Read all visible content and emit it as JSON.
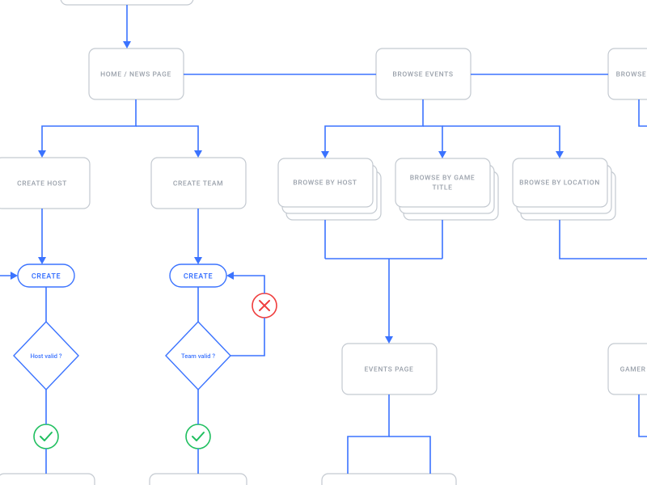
{
  "nodes": {
    "home": {
      "label": "HOME / NEWS PAGE"
    },
    "browseEvents": {
      "label": "BROWSE EVENTS"
    },
    "browseG": {
      "label": "BROWSE G"
    },
    "createHost": {
      "label": "CREATE HOST"
    },
    "createTeam": {
      "label": "CREATE TEAM"
    },
    "byHost": {
      "label": "BROWSE BY HOST"
    },
    "byGameTitle": {
      "label": "BROWSE BY GAME TITLE"
    },
    "byLocation": {
      "label": "BROWSE BY LOCATION"
    },
    "eventsPage": {
      "label": "EVENTS PAGE"
    },
    "gamerP": {
      "label": "GAMER P"
    }
  },
  "pills": {
    "create1": {
      "label": "CREATE"
    },
    "create2": {
      "label": "CREATE"
    }
  },
  "decisions": {
    "hostValid": {
      "label": "Host valid ?"
    },
    "teamValid": {
      "label": "Team valid ?"
    }
  },
  "badges": {
    "ok1": {
      "kind": "ok"
    },
    "ok2": {
      "kind": "ok"
    },
    "fail": {
      "kind": "fail"
    }
  },
  "colors": {
    "line": "#3b73ff",
    "node_stroke": "#c3c9d0",
    "text": "#9aa1ab",
    "ok": "#1fbf5f",
    "fail": "#ef3e3e"
  }
}
